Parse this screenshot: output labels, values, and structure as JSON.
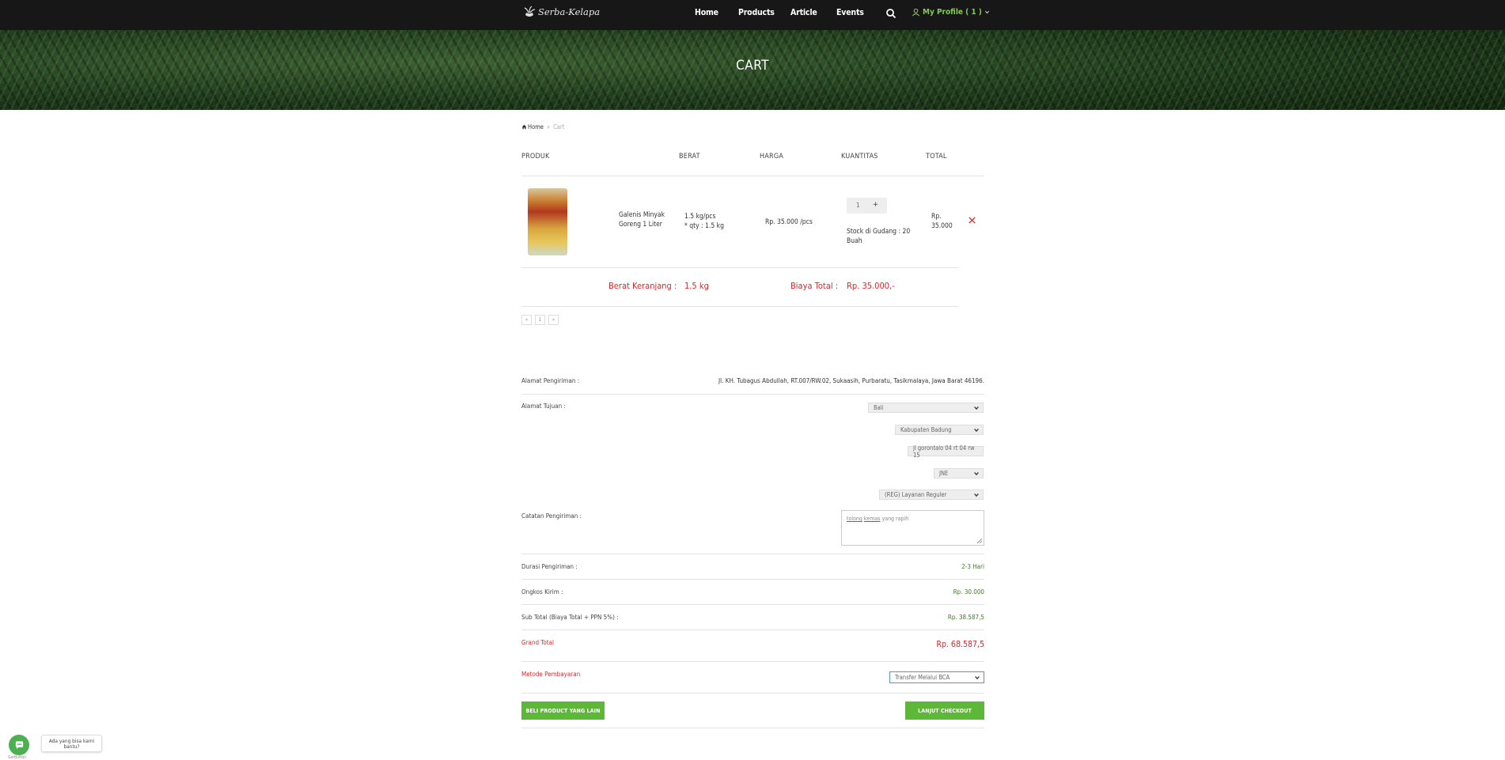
{
  "nav": {
    "logo_text": "Serba-Kelapa",
    "home": "Home",
    "products": "Products",
    "article": "Article",
    "events": "Events",
    "profile": "My Profile ( 1 )"
  },
  "hero": {
    "title": "CART"
  },
  "breadcrumb": {
    "home": "Home",
    "sep": "»",
    "current": "Cart"
  },
  "table": {
    "headers": {
      "produk": "PRODUK",
      "berat": "BERAT",
      "harga": "HARGA",
      "kuantitas": "KUANTITAS",
      "total": "TOTAL"
    },
    "row": {
      "name_line1": "Galenis Minyak",
      "name_line2": "Goreng 1 Liter",
      "weight_line1": "1.5 kg/pcs",
      "weight_line2": "* qty : 1.5 kg",
      "price": "Rp. 35.000 /pcs",
      "qty": "1",
      "qty_plus": "+",
      "stock_line1": "Stock di Gudang : 20",
      "stock_line2": "Buah",
      "total_line1": "Rp.",
      "total_line2": "35.000"
    },
    "summary": {
      "weight_label": "Berat Keranjang :",
      "weight_value": "1.5 kg",
      "cost_label": "Biaya Total :",
      "cost_value": "Rp. 35.000,-"
    }
  },
  "pager": {
    "prev": "«",
    "page": "1",
    "next": "»"
  },
  "form": {
    "alamat_pengiriman_label": "Alamat Pengiriman :",
    "alamat_pengiriman_value": "Jl. KH. Tubagus Abdullah, RT.007/RW.02, Sukaasih, Purbaratu, Tasikmalaya, Jawa Barat 46196.",
    "alamat_tujuan_label": "Alamat Tujuan :",
    "province": "Bali",
    "city": "Kabupaten Badung",
    "address_input": "jl gorontalo 04 rt 04 rw 15",
    "courier": "JNE",
    "service": "(REG) Layanan Reguler",
    "catatan_label": "Catatan Pengiriman :",
    "catatan_word1": "tolong",
    "catatan_word2": "kemas",
    "catatan_rest": " yang rapih",
    "durasi_label": "Durasi Pengiriman :",
    "durasi_value": "2-3 Hari",
    "ongkos_label": "Ongkos Kirim :",
    "ongkos_value": "Rp. 30.000",
    "subtotal_label": "Sub Total (Biaya Total + PPN 5%) :",
    "subtotal_value": "Rp. 38.587,5",
    "grand_label": "Grand Total",
    "grand_value": "Rp. 68.587,5",
    "metode_label": "Metode Pembayaran",
    "metode_value": "Transfer Melalui BCA"
  },
  "buttons": {
    "beli": "BELI PRODUCT YANG LAIN",
    "checkout": "LANJUT CHECKOUT"
  },
  "chat": {
    "bubble": "Ada yang bisa kami bantu?",
    "brand": "GetButton"
  },
  "colors": {
    "accent_green": "#5cb836",
    "accent_red": "#e0232a",
    "nav_bg": "#171717"
  }
}
